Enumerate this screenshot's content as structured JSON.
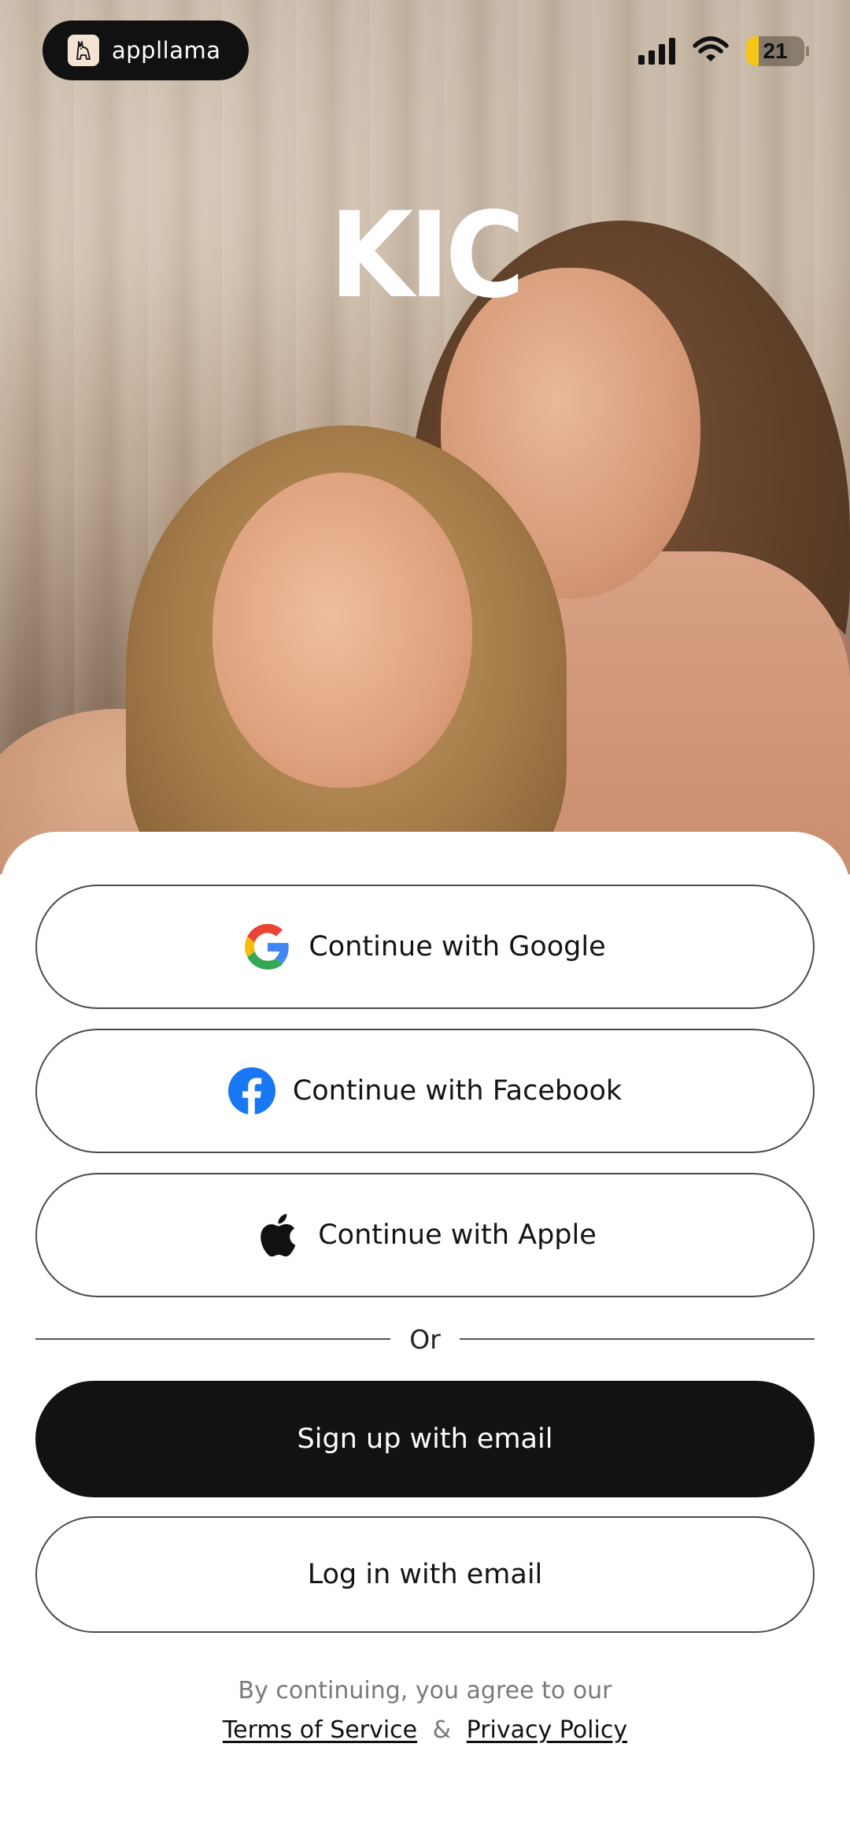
{
  "status_bar": {
    "app_badge_name": "appllama",
    "battery_level": "21"
  },
  "hero": {
    "brand_logo": "KIC"
  },
  "auth": {
    "google_label": "Continue with Google",
    "facebook_label": "Continue with Facebook",
    "apple_label": "Continue with Apple",
    "divider_label": "Or",
    "signup_email_label": "Sign up with email",
    "login_email_label": "Log in with email"
  },
  "legal": {
    "prefix": "By continuing, you agree to our",
    "terms_label": "Terms of Service",
    "ampersand": "&",
    "privacy_label": "Privacy Policy"
  },
  "icons": {
    "google": "google-icon",
    "facebook": "facebook-icon",
    "apple": "apple-icon",
    "signal": "cellular-signal-icon",
    "wifi": "wifi-icon",
    "battery": "battery-icon",
    "llama": "llama-logo-icon"
  },
  "colors": {
    "primary_button": "#111214",
    "facebook_blue": "#1877F2",
    "battery_fill": "#F5C518"
  }
}
